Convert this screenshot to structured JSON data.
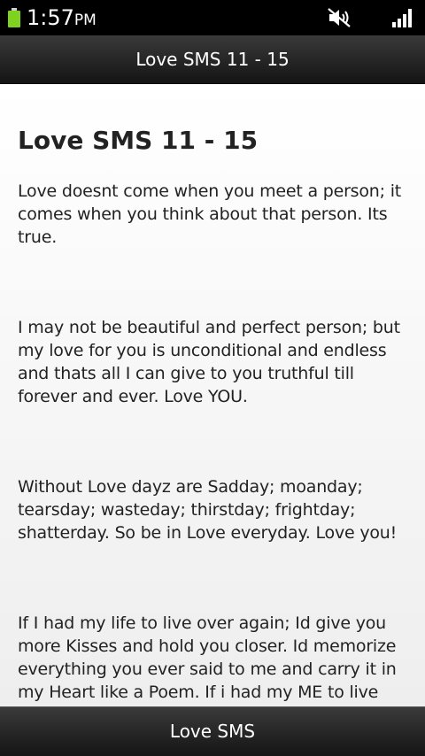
{
  "status_bar": {
    "time": "1:57",
    "ampm": "PM",
    "battery_color": "#7ed321",
    "icons": [
      "battery-icon",
      "mute-icon",
      "signal-icon"
    ]
  },
  "title_bar": {
    "title": "Love SMS 11 - 15"
  },
  "content": {
    "heading": "Love SMS 11 - 15",
    "messages": [
      "Love doesnt come when you meet a person; it comes when you think about that person. Its true.",
      "I may not be beautiful and perfect person; but my love for you is unconditional and endless and thats all I can give to you truthful till forever and ever. Love YOU.",
      "Without Love dayz are Sadday; moanday; tearsday; wasteday; thirstday; frightday; shatterday. So be in Love everyday. Love you!",
      "If I had my life to live over again; Id give you more Kisses and hold you closer. Id memorize everything you ever said to me and carry it in my Heart like a Poem. If i had my ME to live over again. Next time Id find you sooner so I could luv you longer, better and truer."
    ]
  },
  "bottom_bar": {
    "label": "Love SMS"
  }
}
